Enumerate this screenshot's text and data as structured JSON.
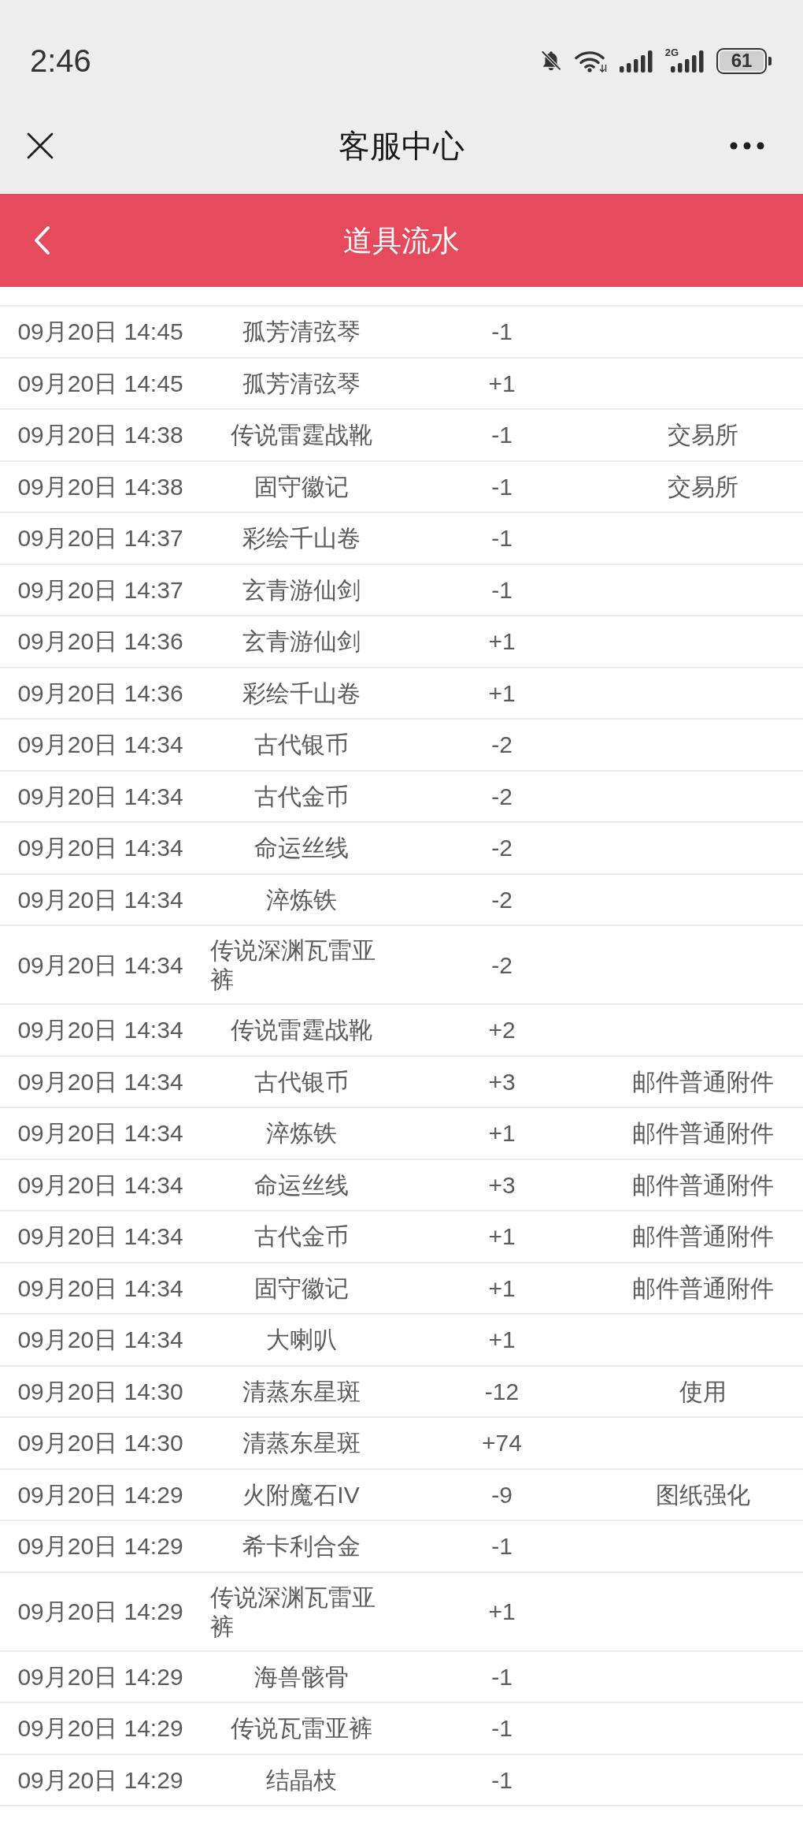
{
  "status_bar": {
    "time": "2:46",
    "network_type": "2G",
    "battery": "61"
  },
  "nav_bar": {
    "title": "客服中心"
  },
  "page_header": {
    "title": "道具流水"
  },
  "table": {
    "rows": [
      {
        "cells": [
          "09月20日 14:45",
          "孤芳清弦琴",
          "-1"
        ]
      },
      {
        "cells": [
          "09月20日 14:45",
          "孤芳清弦琴",
          "+1"
        ]
      },
      {
        "cells": [
          "09月20日 14:38",
          "传说雷霆战靴",
          "-1",
          "交易所"
        ]
      },
      {
        "cells": [
          "09月20日 14:38",
          "固守徽记",
          "-1",
          "交易所"
        ]
      },
      {
        "cells": [
          "09月20日 14:37",
          "彩绘千山卷",
          "-1"
        ]
      },
      {
        "cells": [
          "09月20日 14:37",
          "玄青游仙剑",
          "-1"
        ]
      },
      {
        "cells": [
          "09月20日 14:36",
          "玄青游仙剑",
          "+1"
        ]
      },
      {
        "cells": [
          "09月20日 14:36",
          "彩绘千山卷",
          "+1"
        ]
      },
      {
        "cells": [
          "09月20日 14:34",
          "古代银币",
          "-2"
        ]
      },
      {
        "cells": [
          "09月20日 14:34",
          "古代金币",
          "-2"
        ]
      },
      {
        "cells": [
          "09月20日 14:34",
          "命运丝线",
          "-2"
        ]
      },
      {
        "cells": [
          "09月20日 14:34",
          "淬炼铁",
          "-2"
        ]
      },
      {
        "cells": [
          "09月20日 14:34",
          "传说深渊瓦雷亚裤",
          "-2"
        ]
      },
      {
        "cells": [
          "09月20日 14:34",
          "传说雷霆战靴",
          "+2"
        ]
      },
      {
        "cells": [
          "09月20日 14:34",
          "古代银币",
          "+3",
          "邮件普通附件"
        ]
      },
      {
        "cells": [
          "09月20日 14:34",
          "淬炼铁",
          "+1",
          "邮件普通附件"
        ]
      },
      {
        "cells": [
          "09月20日 14:34",
          "命运丝线",
          "+3",
          "邮件普通附件"
        ]
      },
      {
        "cells": [
          "09月20日 14:34",
          "古代金币",
          "+1",
          "邮件普通附件"
        ]
      },
      {
        "cells": [
          "09月20日 14:34",
          "固守徽记",
          "+1",
          "邮件普通附件"
        ]
      },
      {
        "cells": [
          "09月20日 14:34",
          "大喇叭",
          "+1"
        ]
      },
      {
        "cells": [
          "09月20日 14:30",
          "清蒸东星斑",
          "-12",
          "使用"
        ]
      },
      {
        "cells": [
          "09月20日 14:30",
          "清蒸东星斑",
          "+74"
        ]
      },
      {
        "cells": [
          "09月20日 14:29",
          "火附魔石IV",
          "-9",
          "图纸强化"
        ]
      },
      {
        "cells": [
          "09月20日 14:29",
          "希卡利合金",
          "-1"
        ]
      },
      {
        "cells": [
          "09月20日 14:29",
          "传说深渊瓦雷亚裤",
          "+1"
        ]
      },
      {
        "cells": [
          "09月20日 14:29",
          "海兽骸骨",
          "-1"
        ]
      },
      {
        "cells": [
          "09月20日 14:29",
          "传说瓦雷亚裤",
          "-1"
        ]
      },
      {
        "cells": [
          "09月20日 14:29",
          "结晶枝",
          "-1"
        ]
      }
    ]
  }
}
